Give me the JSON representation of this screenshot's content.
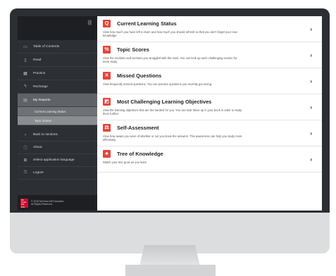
{
  "sidebar": {
    "items": [
      {
        "label": "Table of Contents",
        "icon": "folder-icon"
      },
      {
        "label": "Read",
        "icon": "document-icon"
      },
      {
        "label": "Practice",
        "icon": "grid-icon"
      },
      {
        "label": "Recharge",
        "icon": "lightning-icon"
      },
      {
        "label": "My Reports",
        "icon": "report-icon"
      }
    ],
    "subitems": [
      "Current Learning Status",
      "Topic Scores"
    ],
    "bottom_items": [
      {
        "label": "Back to sections",
        "icon": "chevron-left-icon"
      },
      {
        "label": "About",
        "icon": "info-icon"
      },
      {
        "label": "Select application language",
        "icon": "language-icon"
      },
      {
        "label": "Logout",
        "icon": "logout-icon"
      }
    ],
    "copyright": [
      "© 2015 McGraw-Hill Education.",
      "All Rights Reserved."
    ]
  },
  "sections": [
    {
      "title": "Current Learning Status",
      "icon": "Q",
      "desc": "View how much you have left to learn and how much you should refresh so that you don't forget your new knowledge."
    },
    {
      "title": "Topic Scores",
      "icon": "%",
      "desc": "View the modules and sections you struggled with the most. You can look up each challenging section for more study."
    },
    {
      "title": "Missed Questions",
      "icon": "✕",
      "desc": "View frequently missed questions. You can practice questions you recently got wrong."
    },
    {
      "title": "Most Challenging Learning Objectives",
      "icon": "◩",
      "desc": "View the learning objectives that are the hardest for you. You can look these up in your book in order to study them further."
    },
    {
      "title": "Self-Assessment",
      "icon": "⚖",
      "desc": "View how aware you were of whether or not you knew the answers. This awareness can help you study more effectively."
    },
    {
      "title": "Tree of Knowledge",
      "icon": "♣",
      "desc": "Watch your tree grow as you learn."
    }
  ],
  "colors": {
    "accent": "#e8443a",
    "sidebar": "#2c2f33"
  }
}
